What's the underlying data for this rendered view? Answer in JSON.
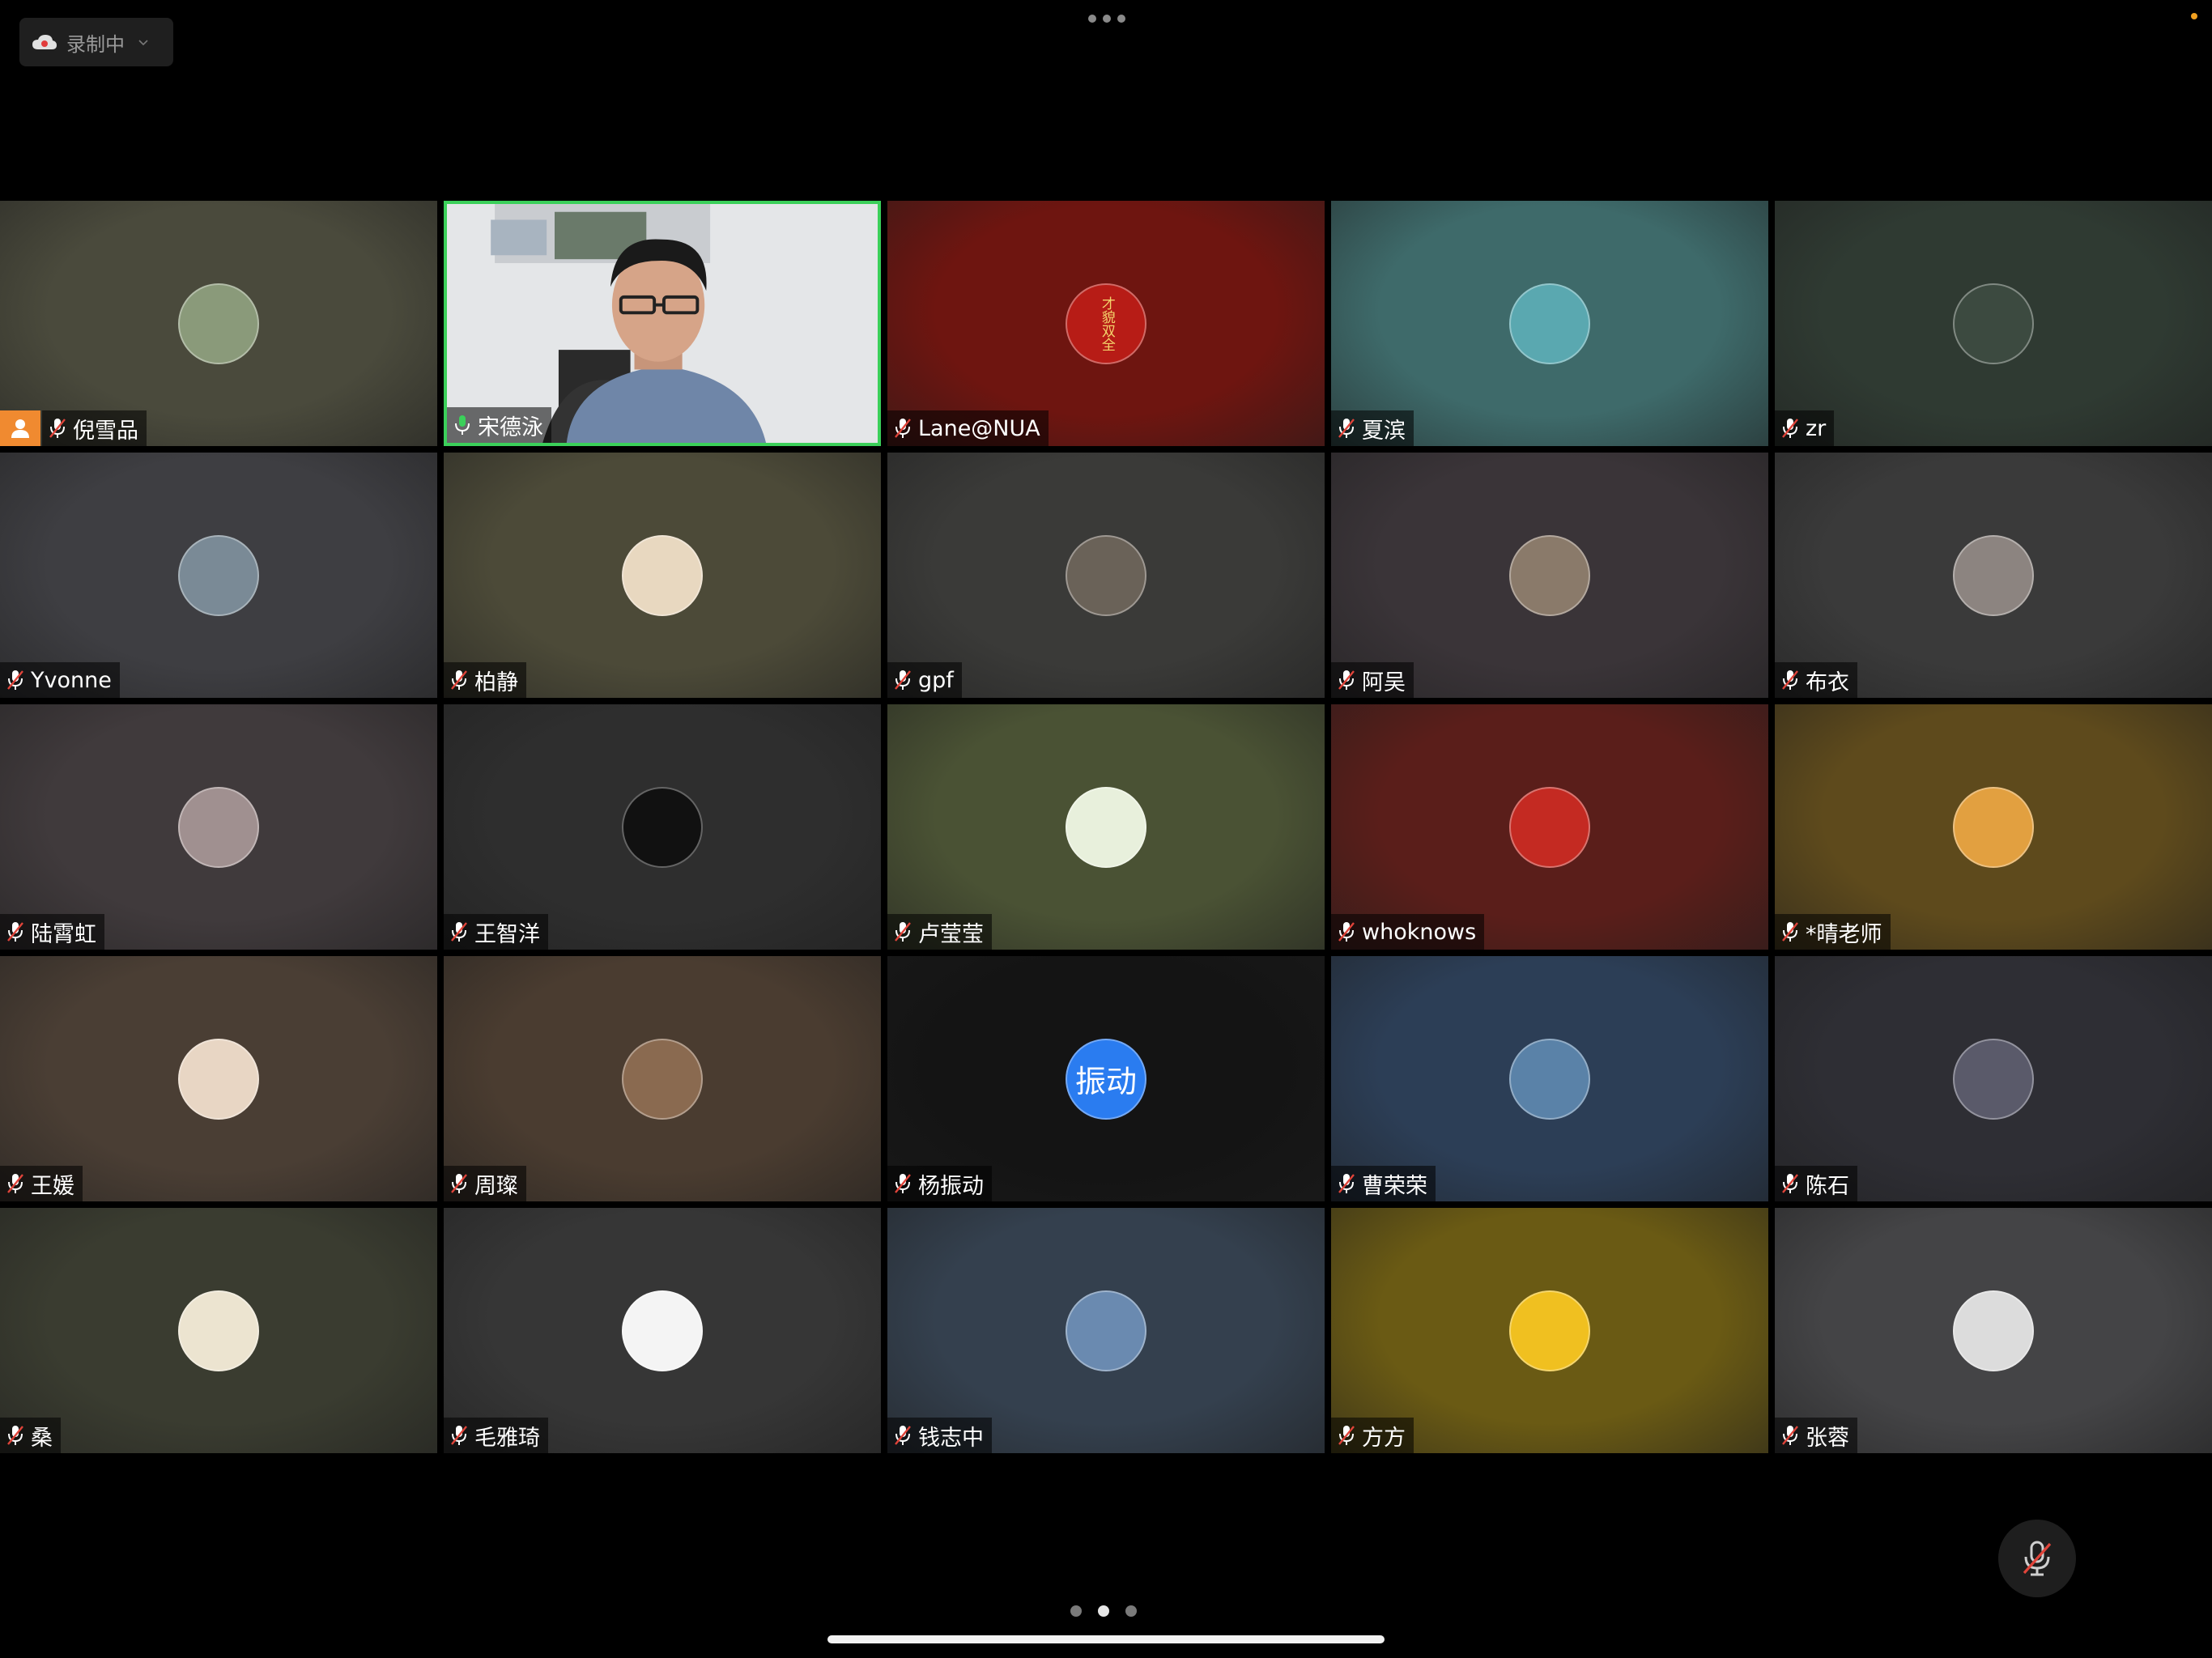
{
  "recording": {
    "label": "录制中",
    "icon": "cloud-record-icon"
  },
  "participants": [
    {
      "name": "倪雪品",
      "mic": "muted",
      "host": true,
      "bg": "#4a4a3c",
      "avatar_bg": "#8a9a7a"
    },
    {
      "name": "宋德泳",
      "mic": "active",
      "speaking": true,
      "video": true
    },
    {
      "name": "Lane@NUA",
      "mic": "muted",
      "bg": "#6e1510",
      "avatar_bg": "#b71c16",
      "avatar_text": "才貌双全"
    },
    {
      "name": "夏滨",
      "mic": "muted",
      "bg": "#3e6a6a",
      "avatar_bg": "#5aa8b0"
    },
    {
      "name": "zr",
      "mic": "muted",
      "bg": "#2f3a32",
      "avatar_bg": "#3c4a40"
    },
    {
      "name": "Yvonne",
      "mic": "muted",
      "bg": "#3e3e42",
      "avatar_bg": "#7a8a96"
    },
    {
      "name": "柏静",
      "mic": "muted",
      "bg": "#4c4a38",
      "avatar_bg": "#e8d8c0"
    },
    {
      "name": "gpf",
      "mic": "muted",
      "bg": "#3a3a38",
      "avatar_bg": "#6a6258"
    },
    {
      "name": "阿吴",
      "mic": "muted",
      "bg": "#3a3438",
      "avatar_bg": "#8a7a6a"
    },
    {
      "name": "布衣",
      "mic": "muted",
      "bg": "#3a3a3a",
      "avatar_bg": "#8c8480"
    },
    {
      "name": "陆霄虹",
      "mic": "muted",
      "bg": "#403a3c",
      "avatar_bg": "#a09090"
    },
    {
      "name": "王智洋",
      "mic": "muted",
      "bg": "#2e2e2e",
      "avatar_bg": "#111111"
    },
    {
      "name": "卢莹莹",
      "mic": "muted",
      "bg": "#4a5234",
      "avatar_bg": "#e8f0dc"
    },
    {
      "name": "whoknows",
      "mic": "muted",
      "bg": "#5a1e1a",
      "avatar_bg": "#c42a22"
    },
    {
      "name": "*晴老师",
      "mic": "muted",
      "bg": "#5e4a1c",
      "avatar_bg": "#e2a040"
    },
    {
      "name": "王媛",
      "mic": "muted",
      "bg": "#4a3e34",
      "avatar_bg": "#e8d6c4"
    },
    {
      "name": "周璨",
      "mic": "muted",
      "bg": "#4a3c30",
      "avatar_bg": "#8a6a50"
    },
    {
      "name": "杨振动",
      "mic": "muted",
      "bg": "#141414",
      "avatar_bg": "#2a7cf0",
      "avatar_text": "振动"
    },
    {
      "name": "曹荣荣",
      "mic": "muted",
      "bg": "#2c3e56",
      "avatar_bg": "#5a82a8"
    },
    {
      "name": "陈石",
      "mic": "muted",
      "bg": "#2e2e34",
      "avatar_bg": "#5a5a6a"
    },
    {
      "name": "桑",
      "mic": "muted",
      "bg": "#3a3c30",
      "avatar_bg": "#ece4d0"
    },
    {
      "name": "毛雅琦",
      "mic": "muted",
      "bg": "#363636",
      "avatar_bg": "#f4f4f4"
    },
    {
      "name": "钱志中",
      "mic": "muted",
      "bg": "#34404e",
      "avatar_bg": "#6a8ab0"
    },
    {
      "name": "方方",
      "mic": "muted",
      "bg": "#6a5a14",
      "avatar_bg": "#f0c020"
    },
    {
      "name": "张蓉",
      "mic": "muted",
      "bg": "#444446",
      "avatar_bg": "#dcdcdc"
    }
  ],
  "controls": {
    "mute_icon": "mic-muted-icon"
  },
  "pager": {
    "pages": 3,
    "current": 2
  }
}
